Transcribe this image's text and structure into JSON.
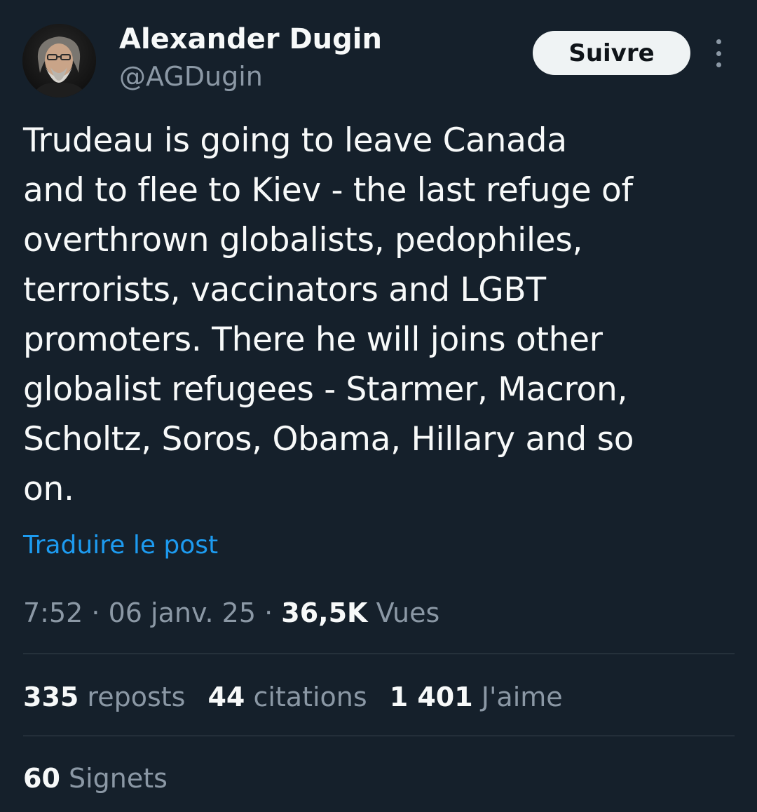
{
  "author": {
    "name": "Alexander Dugin",
    "handle": "@AGDugin",
    "follow_label": "Suivre"
  },
  "post": {
    "text": "Trudeau is going to leave Canada\nand to flee to Kiev - the last refuge of\noverthrown globalists, pedophiles,\nterrorists, vaccinators and LGBT\npromoters. There he will joins other\nglobalist refugees - Starmer, Macron,\nScholtz, Soros, Obama, Hillary and so\non.",
    "translate_label": "Traduire le post"
  },
  "meta": {
    "time": "7:52",
    "separator": " · ",
    "date": "06 janv. 25",
    "views_count": "36,5K",
    "views_label": "Vues"
  },
  "stats": {
    "reposts_count": "335",
    "reposts_label": "reposts",
    "quotes_count": "44",
    "quotes_label": "citations",
    "likes_count": "1 401",
    "likes_label": "J'aime",
    "bookmarks_count": "60",
    "bookmarks_label": "Signets"
  },
  "colors": {
    "background": "#15202b",
    "text_primary": "#f7f9f9",
    "text_secondary": "#8b98a5",
    "link": "#1d9bf0",
    "divider": "#38444d",
    "follow_button_bg": "#eff3f4"
  },
  "icons": {
    "more": "more-vertical-icon"
  }
}
